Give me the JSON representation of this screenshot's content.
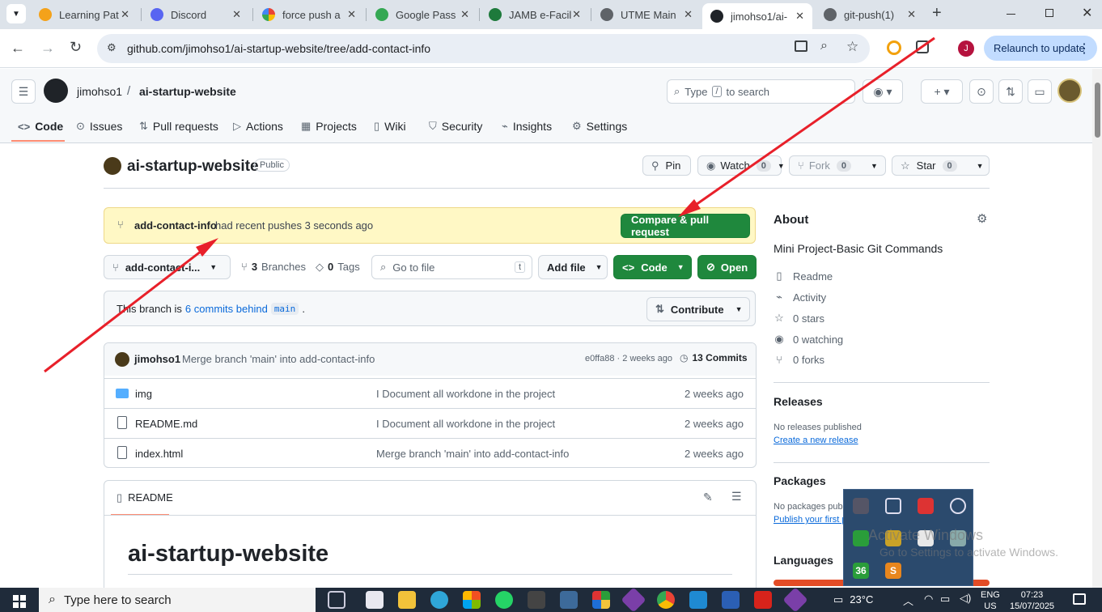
{
  "browser": {
    "tabs": [
      {
        "label": "Learning Pat",
        "color": "#f4a21a"
      },
      {
        "label": "Discord",
        "color": "#5865f2"
      },
      {
        "label": "force push a",
        "color": "#4285f4"
      },
      {
        "label": "Google Pass",
        "color": "#34a853"
      },
      {
        "label": "JAMB e-Facil",
        "color": "#1e7a3c"
      },
      {
        "label": "UTME Main",
        "color": "#5f6368"
      },
      {
        "label": "jimohso1/ai-",
        "color": "#1f2328"
      },
      {
        "label": "git-push(1)",
        "color": "#5f6368"
      }
    ],
    "tab_close": "✕",
    "new_tab": "+",
    "url": "github.com/jimohso1/ai-startup-website/tree/add-contact-info",
    "profile_initial": "J",
    "relaunch_label": "Relaunch to update"
  },
  "github": {
    "owner": "jimohso1",
    "separator": "/",
    "repo": "ai-startup-website",
    "search_prefix": "Type",
    "search_key": "/",
    "search_suffix": "to search",
    "nav": [
      "Code",
      "Issues",
      "Pull requests",
      "Actions",
      "Projects",
      "Wiki",
      "Security",
      "Insights",
      "Settings"
    ],
    "visibility": "Public",
    "pin_label": "Pin",
    "watch_label": "Watch",
    "watch_count": "0",
    "fork_label": "Fork",
    "fork_count": "0",
    "star_label": "Star",
    "star_count": "0",
    "push_banner": {
      "branch": "add-contact-info",
      "text": "had recent pushes 3 seconds ago",
      "button": "Compare & pull request"
    },
    "branch_select": "add-contact-i...",
    "branches_count": "3",
    "branches_label": "Branches",
    "tags_count": "0",
    "tags_label": "Tags",
    "goto_placeholder": "Go to file",
    "goto_key": "t",
    "add_file": "Add file",
    "code_button": "Code",
    "open_button": "Open",
    "behind": {
      "prefix": "This branch is",
      "link": "6 commits behind",
      "base": "main",
      "suffix": "."
    },
    "contribute": "Contribute",
    "latest_commit": {
      "author": "jimohso1",
      "message": "Merge branch 'main' into add-contact-info",
      "hash_time": "e0ffa88 · 2 weeks ago",
      "commits": "13 Commits"
    },
    "files": [
      {
        "name": "img",
        "type": "folder",
        "message": "I Document all workdone in the project",
        "age": "2 weeks ago"
      },
      {
        "name": "README.md",
        "type": "file",
        "message": "I Document all workdone in the project",
        "age": "2 weeks ago"
      },
      {
        "name": "index.html",
        "type": "file",
        "message": "Merge branch 'main' into add-contact-info",
        "age": "2 weeks ago"
      }
    ],
    "readme_tab": "README",
    "readme_heading": "ai-startup-website",
    "about": {
      "title": "About",
      "description": "Mini Project-Basic Git Commands",
      "items": [
        "Readme",
        "Activity",
        "0 stars",
        "0 watching",
        "0 forks"
      ]
    },
    "releases": {
      "title": "Releases",
      "none": "No releases published",
      "link": "Create a new release"
    },
    "packages": {
      "title": "Packages",
      "none": "No packages publ",
      "link": "Publish your first p"
    },
    "languages_title": "Languages"
  },
  "taskbar": {
    "search_placeholder": "Type here to search",
    "weather": "23°C",
    "lang_top": "ENG",
    "lang_bottom": "US",
    "time": "07:23",
    "date": "15/07/2025",
    "tray_36": "36",
    "tray_s": "S"
  },
  "watermark": {
    "line1": "Activate Windows",
    "line2": "Go to Settings to activate Windows."
  },
  "colors": {
    "accent_green": "#1f883d",
    "link_blue": "#0969da",
    "annotation_red": "#e8202a",
    "banner_bg": "#fff8c5"
  }
}
